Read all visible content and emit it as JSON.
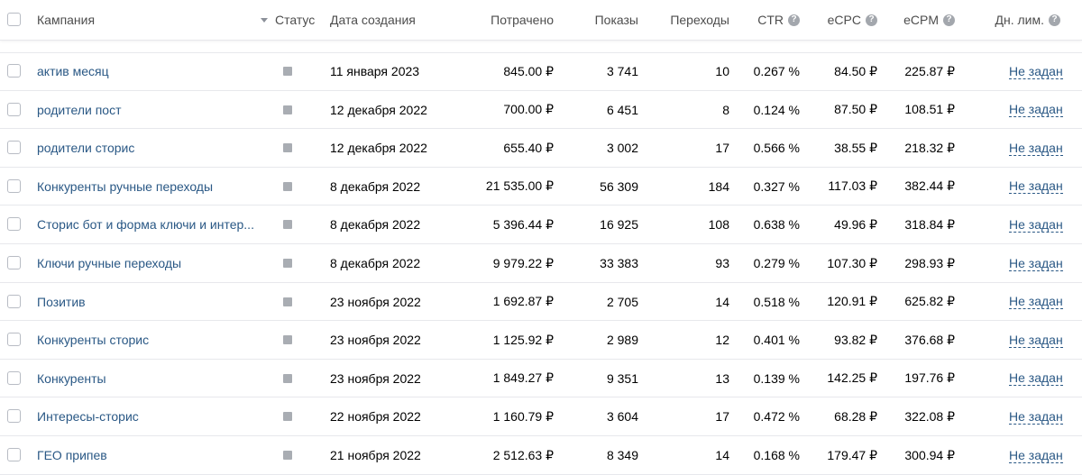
{
  "header": {
    "campaign": "Кампания",
    "status": "Статус",
    "created": "Дата создания",
    "spent": "Потрачено",
    "impressions": "Показы",
    "clicks": "Переходы",
    "ctr": "CTR",
    "ecpc": "eCPC",
    "ecpm": "eCPM",
    "daily_limit": "Дн. лим.",
    "help_icon": "?"
  },
  "rows": [
    {
      "name": "актив месяц",
      "date": "11 января 2023",
      "spent": "845.00 ₽",
      "impressions": "3 741",
      "clicks": "10",
      "ctr": "0.267 %",
      "ecpc": "84.50 ₽",
      "ecpm": "225.87 ₽",
      "limit": "Не задан"
    },
    {
      "name": "родители пост",
      "date": "12 декабря 2022",
      "spent": "700.00 ₽",
      "impressions": "6 451",
      "clicks": "8",
      "ctr": "0.124 %",
      "ecpc": "87.50 ₽",
      "ecpm": "108.51 ₽",
      "limit": "Не задан"
    },
    {
      "name": "родители сторис",
      "date": "12 декабря 2022",
      "spent": "655.40 ₽",
      "impressions": "3 002",
      "clicks": "17",
      "ctr": "0.566 %",
      "ecpc": "38.55 ₽",
      "ecpm": "218.32 ₽",
      "limit": "Не задан"
    },
    {
      "name": "Конкуренты ручные переходы",
      "date": "8 декабря 2022",
      "spent": "21 535.00 ₽",
      "impressions": "56 309",
      "clicks": "184",
      "ctr": "0.327 %",
      "ecpc": "117.03 ₽",
      "ecpm": "382.44 ₽",
      "limit": "Не задан"
    },
    {
      "name": "Сторис бот и форма ключи и интер...",
      "date": "8 декабря 2022",
      "spent": "5 396.44 ₽",
      "impressions": "16 925",
      "clicks": "108",
      "ctr": "0.638 %",
      "ecpc": "49.96 ₽",
      "ecpm": "318.84 ₽",
      "limit": "Не задан"
    },
    {
      "name": "Ключи ручные переходы",
      "date": "8 декабря 2022",
      "spent": "9 979.22 ₽",
      "impressions": "33 383",
      "clicks": "93",
      "ctr": "0.279 %",
      "ecpc": "107.30 ₽",
      "ecpm": "298.93 ₽",
      "limit": "Не задан"
    },
    {
      "name": "Позитив",
      "date": "23 ноября 2022",
      "spent": "1 692.87 ₽",
      "impressions": "2 705",
      "clicks": "14",
      "ctr": "0.518 %",
      "ecpc": "120.91 ₽",
      "ecpm": "625.82 ₽",
      "limit": "Не задан"
    },
    {
      "name": "Конкуренты сторис",
      "date": "23 ноября 2022",
      "spent": "1 125.92 ₽",
      "impressions": "2 989",
      "clicks": "12",
      "ctr": "0.401 %",
      "ecpc": "93.82 ₽",
      "ecpm": "376.68 ₽",
      "limit": "Не задан"
    },
    {
      "name": "Конкуренты",
      "date": "23 ноября 2022",
      "spent": "1 849.27 ₽",
      "impressions": "9 351",
      "clicks": "13",
      "ctr": "0.139 %",
      "ecpc": "142.25 ₽",
      "ecpm": "197.76 ₽",
      "limit": "Не задан"
    },
    {
      "name": "Интересы-сторис",
      "date": "22 ноября 2022",
      "spent": "1 160.79 ₽",
      "impressions": "3 604",
      "clicks": "17",
      "ctr": "0.472 %",
      "ecpc": "68.28 ₽",
      "ecpm": "322.08 ₽",
      "limit": "Не задан"
    },
    {
      "name": "ГЕО припев",
      "date": "21 ноября 2022",
      "spent": "2 512.63 ₽",
      "impressions": "8 349",
      "clicks": "14",
      "ctr": "0.168 %",
      "ecpc": "179.47 ₽",
      "ecpm": "300.94 ₽",
      "limit": "Не задан"
    }
  ],
  "colors": {
    "link": "#2a5885",
    "status_inactive": "#a9adb3",
    "border": "#e7e8ec",
    "header_text": "#4d4d4d"
  },
  "icons": {
    "sort": "sort-desc-icon",
    "help": "help-circle-icon",
    "status": "status-square-icon"
  }
}
